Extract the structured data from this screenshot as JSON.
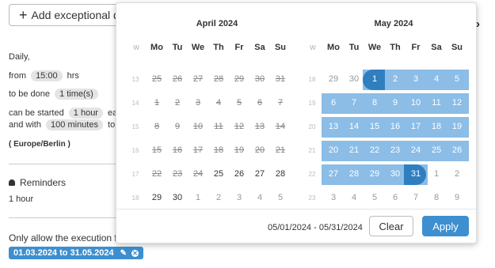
{
  "add_exceptional_label": "Add exceptional da",
  "schedule": {
    "daily": "Daily,",
    "from_label": "from",
    "from_time": "15:00",
    "hrs": "hrs",
    "done_label": "to be done",
    "done_times": "1 time(s)",
    "started_label": "can be started",
    "started_value": "1 hour",
    "started_suffix": "earl",
    "with_label": "and with",
    "with_value": "100 minutes",
    "with_suffix": "to c",
    "timezone": "( Europe/Berlin )"
  },
  "reminders": {
    "title": "Reminders",
    "value": "1 hour"
  },
  "only_allow": "Only allow the execution for",
  "date_chip": "01.03.2024 to 31.05.2024",
  "picker": {
    "weekday_headers": [
      "W",
      "Mo",
      "Tu",
      "We",
      "Th",
      "Fr",
      "Sa",
      "Su"
    ],
    "months": [
      {
        "title": "April 2024",
        "weeks": [
          {
            "wk": "13",
            "days": [
              "25",
              "26",
              "27",
              "28",
              "29",
              "30",
              "31"
            ],
            "states": [
              "dis",
              "dis",
              "dis",
              "dis",
              "dis",
              "dis",
              "dis"
            ]
          },
          {
            "wk": "14",
            "days": [
              "1",
              "2",
              "3",
              "4",
              "5",
              "6",
              "7"
            ],
            "states": [
              "dis",
              "dis",
              "dis",
              "dis",
              "dis",
              "dis",
              "dis"
            ]
          },
          {
            "wk": "15",
            "days": [
              "8",
              "9",
              "10",
              "11",
              "12",
              "13",
              "14"
            ],
            "states": [
              "dis",
              "dis",
              "dis",
              "dis",
              "dis",
              "dis",
              "dis"
            ]
          },
          {
            "wk": "16",
            "days": [
              "15",
              "16",
              "17",
              "18",
              "19",
              "20",
              "21"
            ],
            "states": [
              "dis",
              "dis",
              "dis",
              "dis",
              "dis",
              "dis",
              "dis"
            ]
          },
          {
            "wk": "17",
            "days": [
              "22",
              "23",
              "24",
              "25",
              "26",
              "27",
              "28"
            ],
            "states": [
              "dis",
              "dis",
              "dis",
              "",
              "",
              "",
              ""
            ]
          },
          {
            "wk": "18",
            "days": [
              "29",
              "30",
              "1",
              "2",
              "3",
              "4",
              "5"
            ],
            "states": [
              "",
              "",
              "off",
              "off",
              "off",
              "off",
              "off"
            ]
          }
        ]
      },
      {
        "title": "May 2024",
        "weeks": [
          {
            "wk": "18",
            "days": [
              "29",
              "30",
              "1",
              "2",
              "3",
              "4",
              "5"
            ],
            "states": [
              "off",
              "off",
              "sel",
              "sel",
              "sel",
              "sel",
              "sel"
            ]
          },
          {
            "wk": "19",
            "days": [
              "6",
              "7",
              "8",
              "9",
              "10",
              "11",
              "12"
            ],
            "states": [
              "sel",
              "sel",
              "sel",
              "sel",
              "sel",
              "sel",
              "sel"
            ]
          },
          {
            "wk": "20",
            "days": [
              "13",
              "14",
              "15",
              "16",
              "17",
              "18",
              "19"
            ],
            "states": [
              "sel",
              "sel",
              "sel",
              "sel",
              "sel",
              "sel",
              "sel"
            ]
          },
          {
            "wk": "21",
            "days": [
              "20",
              "21",
              "22",
              "23",
              "24",
              "25",
              "26"
            ],
            "states": [
              "sel",
              "sel",
              "sel",
              "sel",
              "sel",
              "sel",
              "sel"
            ]
          },
          {
            "wk": "22",
            "days": [
              "27",
              "28",
              "29",
              "30",
              "31",
              "1",
              "2"
            ],
            "states": [
              "sel",
              "sel",
              "sel",
              "sel",
              "sel",
              "off",
              "off"
            ]
          },
          {
            "wk": "23",
            "days": [
              "3",
              "4",
              "5",
              "6",
              "7",
              "8",
              "9"
            ],
            "states": [
              "off",
              "off",
              "off",
              "off",
              "off",
              "off",
              "off"
            ]
          }
        ]
      }
    ],
    "range_text": "05/01/2024 - 05/31/2024",
    "clear_label": "Clear",
    "apply_label": "Apply",
    "colors": {
      "range": "#8bbde6",
      "endpoint": "#2f7fc0",
      "accent": "#3d8fcf"
    }
  }
}
